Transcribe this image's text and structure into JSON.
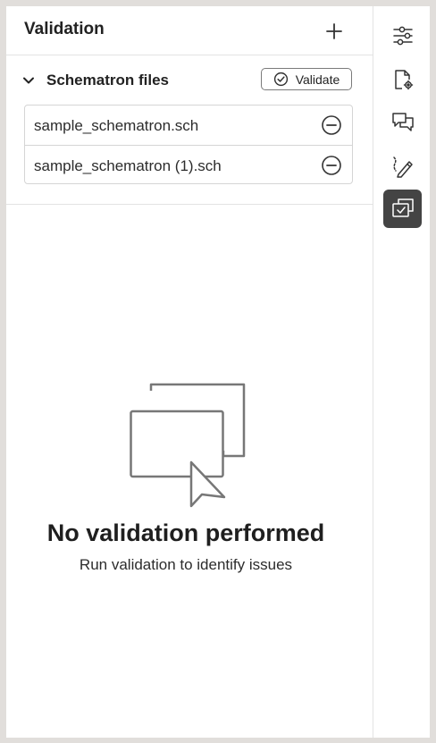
{
  "panel": {
    "title": "Validation",
    "add_icon": "plus-icon"
  },
  "section": {
    "title": "Schematron files",
    "expanded": true,
    "validate_label": "Validate"
  },
  "files": [
    {
      "name": "sample_schematron.sch"
    },
    {
      "name": "sample_schematron (1).sch"
    }
  ],
  "empty_state": {
    "title": "No validation performed",
    "subtitle": "Run validation to identify issues"
  },
  "rail": {
    "items": [
      {
        "icon": "sliders-icon",
        "active": false
      },
      {
        "icon": "document-settings-icon",
        "active": false
      },
      {
        "icon": "comments-icon",
        "active": false
      },
      {
        "icon": "pencil-icon",
        "active": false
      },
      {
        "icon": "validation-icon",
        "active": true
      }
    ]
  },
  "colors": {
    "active_rail": "#444444",
    "background": "#e1dedb"
  }
}
